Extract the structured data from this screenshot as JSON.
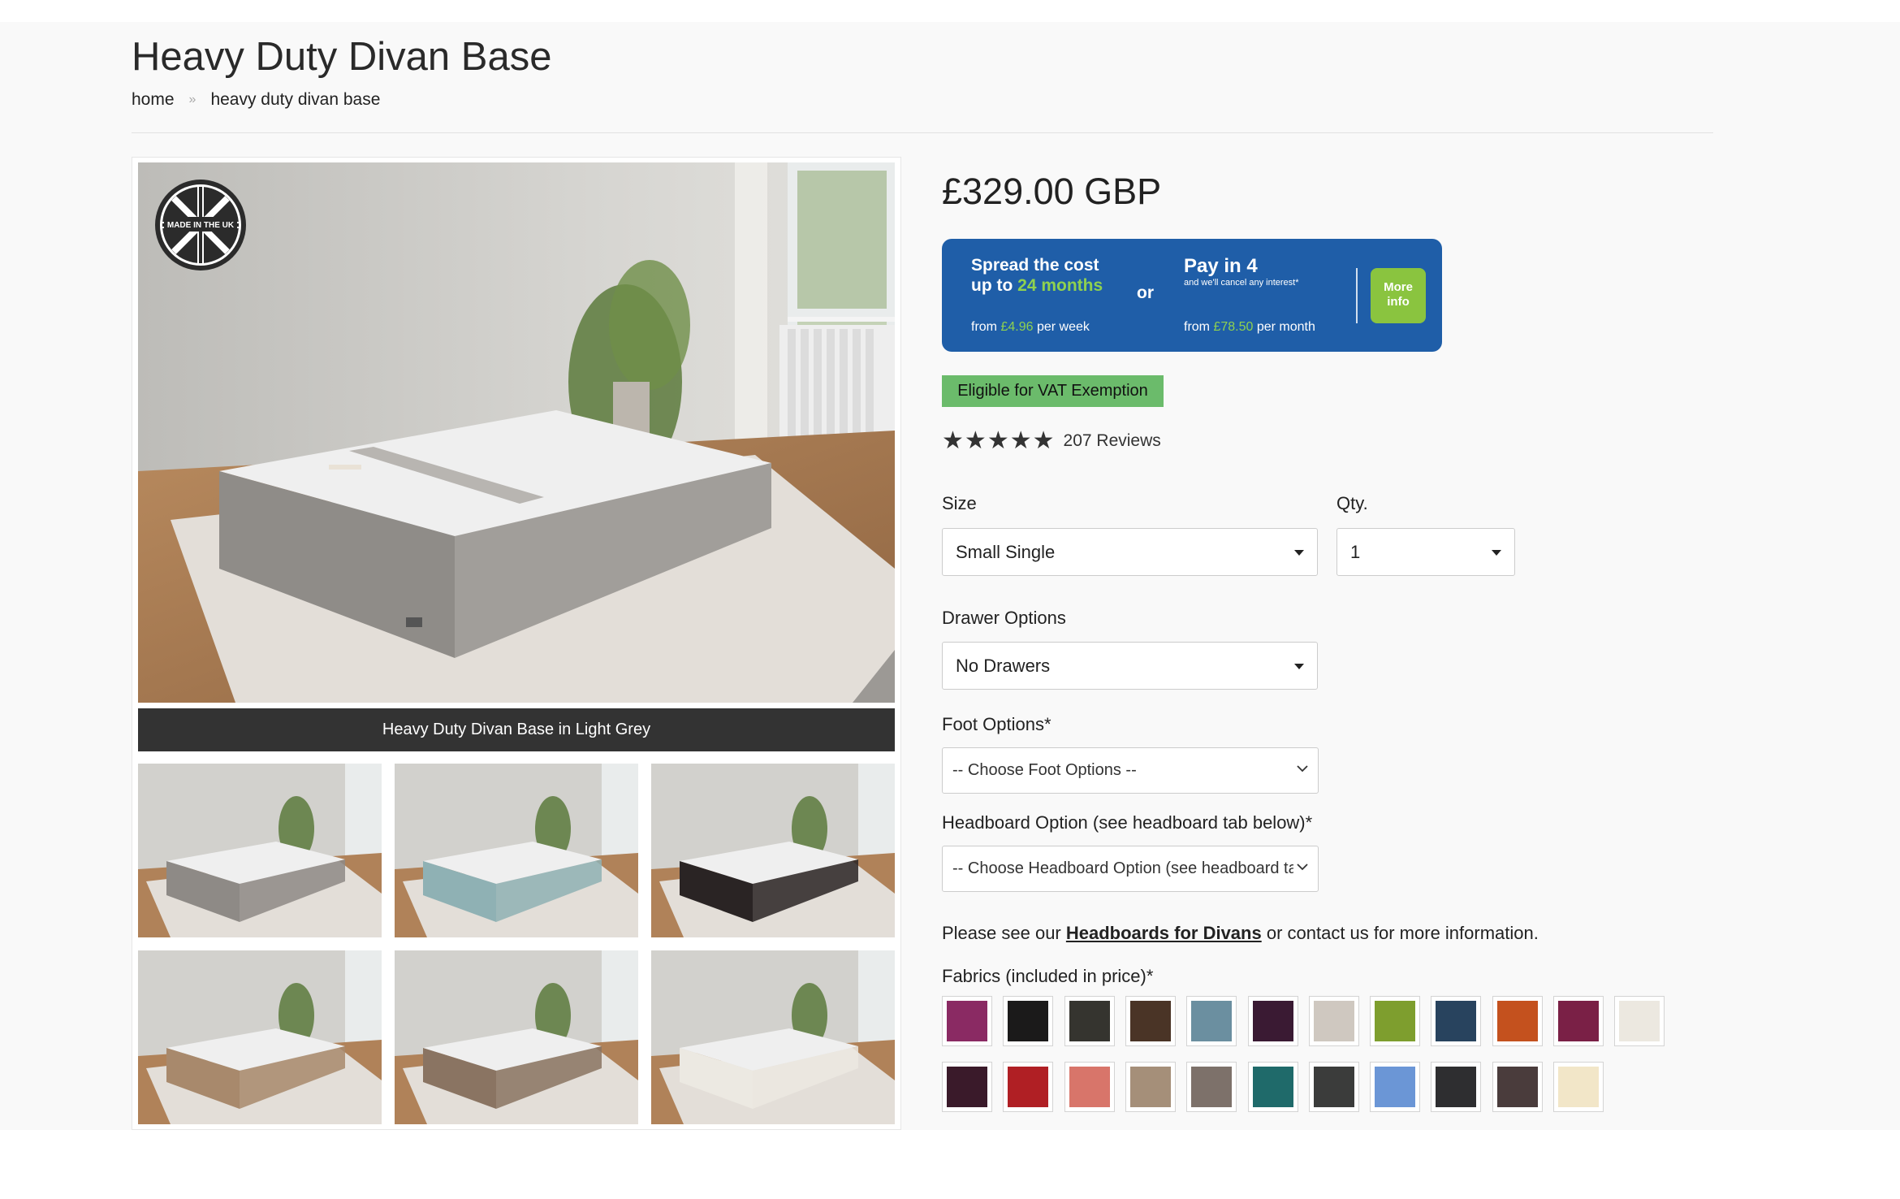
{
  "page": {
    "title": "Heavy Duty Divan Base",
    "breadcrumb": {
      "home": "home",
      "separator": "»",
      "current": "heavy duty divan base"
    }
  },
  "gallery": {
    "badge_text": "MADE IN THE UK",
    "caption": "Heavy Duty Divan Base in Light Grey",
    "thumb_colors": [
      "#8e8a86",
      "#8fb1b4",
      "#2a2424",
      "#a8896c",
      "#8a7462",
      "#ece9e2"
    ]
  },
  "product": {
    "price": "£329.00 GBP",
    "finance": {
      "spread_line1": "Spread the cost",
      "spread_line2_prefix": "up to ",
      "spread_line2_highlight": "24 months",
      "weekly_prefix": "from ",
      "weekly_amount": "£4.96",
      "weekly_suffix": " per week",
      "or": "or",
      "pay4_title": "Pay in 4",
      "pay4_note": "and we'll cancel any interest*",
      "monthly_prefix": "from ",
      "monthly_amount": "£78.50",
      "monthly_suffix": " per month",
      "more_info_line1": "More",
      "more_info_line2": "info"
    },
    "vat_badge": "Eligible for VAT Exemption",
    "rating": {
      "stars": 5,
      "reviews_text": "207 Reviews"
    },
    "size": {
      "label": "Size",
      "value": "Small Single"
    },
    "qty": {
      "label": "Qty.",
      "value": "1"
    },
    "drawer": {
      "label": "Drawer Options",
      "value": "No Drawers"
    },
    "foot": {
      "label": "Foot Options*",
      "value": "-- Choose Foot Options --"
    },
    "headboard": {
      "label": "Headboard Option (see headboard tab below)*",
      "value": "-- Choose Headboard Option (see headboard tab below) --"
    },
    "info_prefix": "Please see our ",
    "info_link": "Headboards for Divans",
    "info_suffix": " or contact us for more information.",
    "fabrics_label": "Fabrics (included in price)*",
    "fabric_row1": [
      "#8a2a63",
      "#1b1a1a",
      "#35342f",
      "#4a3426",
      "#6b8fa0",
      "#3a1a33",
      "#cfc8c0",
      "#7e9e2e",
      "#28435e",
      "#c4511e",
      "#7a2046",
      "#ece8e0"
    ],
    "fabric_row2": [
      "#3a1a2a",
      "#b01f24",
      "#d8756a",
      "#a58f79",
      "#7d716a",
      "#1f6a6a",
      "#3b3c3b",
      "#6b96d6",
      "#2e2e30",
      "#4a3c3c",
      "#f2e6c8"
    ]
  },
  "colors": {
    "finance_blue": "#1f5ea8",
    "finance_green": "#8ac43f",
    "vat_green": "#6bbb6b",
    "caption_bg": "#333333"
  }
}
